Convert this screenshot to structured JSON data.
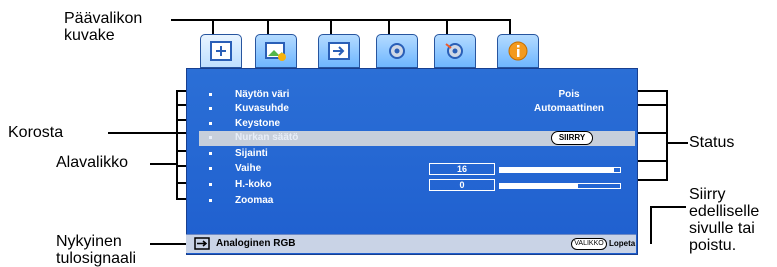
{
  "callouts": {
    "paavalikon_kuvake": "Päävalikon\nkuvake",
    "korosta": "Korosta",
    "alavalikko": "Alavalikko",
    "nykyinen_tulosignaali": "Nykyinen\ntulosignaali",
    "status": "Status",
    "siirry_edelliselle": "Siirry\nedelliselle\nsivulle tai\npoistu."
  },
  "menu": {
    "tabs": [
      {
        "icon": "image-settings-icon"
      },
      {
        "icon": "picture-mode-icon"
      },
      {
        "icon": "source-input-icon"
      },
      {
        "icon": "settings-gear-icon"
      },
      {
        "icon": "advanced-gear-icon"
      },
      {
        "icon": "info-icon"
      }
    ],
    "items": [
      {
        "label": "Näytön väri",
        "value": "Pois"
      },
      {
        "label": "Kuvasuhde",
        "value": "Automaattinen"
      },
      {
        "label": "Keystone",
        "value": ""
      },
      {
        "label": "Nurkan säätö",
        "value": "SIIRRY"
      },
      {
        "label": "Sijainti",
        "value": ""
      },
      {
        "label": "Vaihe",
        "value": "16",
        "level": 0.95
      },
      {
        "label": "H.-koko",
        "value": "0",
        "level": 0.65
      },
      {
        "label": "Zoomaa",
        "value": ""
      }
    ]
  },
  "status_bar": {
    "input_label": "Analoginen RGB",
    "valikko_button": "VALIKKO",
    "lopeta_label": "Lopeta"
  }
}
